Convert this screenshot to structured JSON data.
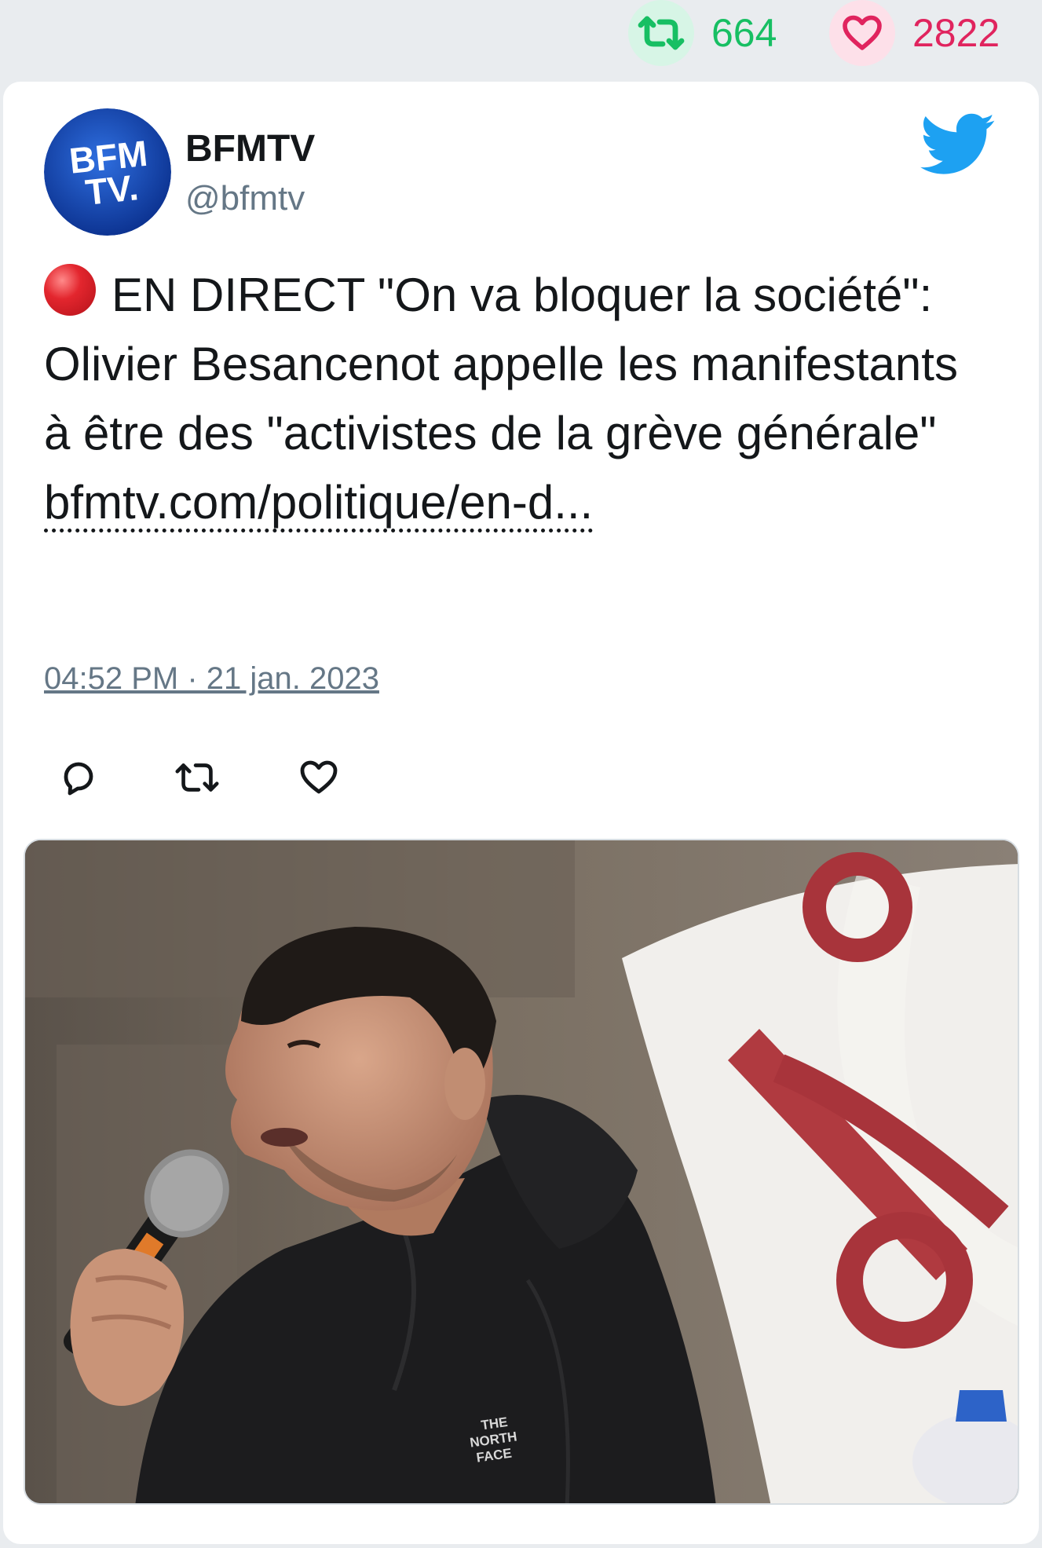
{
  "stats": {
    "retweets": "664",
    "likes": "2822"
  },
  "account": {
    "avatar_text_line1": "BFM",
    "avatar_text_line2": "TV.",
    "name": "BFMTV",
    "handle": "@bfmtv"
  },
  "tweet": {
    "text": "EN DIRECT \"On va bloquer la société\": Olivier Besancenot appelle les manifestants à être des \"activistes de la grève générale\" ",
    "link": "bfmtv.com/politique/en-d...",
    "timestamp": "04:52 PM · 21 jan. 2023"
  },
  "icons": {
    "retweet_stat": "retweet-icon",
    "like_stat": "heart-icon",
    "logo": "twitter-bird-icon",
    "live": "red-circle-icon",
    "reply_action": "reply-icon",
    "retweet_action": "retweet-icon",
    "like_action": "heart-icon"
  },
  "colors": {
    "retweet": "#17bf63",
    "like": "#e0245e",
    "twitter_blue": "#1da1f2",
    "muted": "#657786",
    "text": "#14171a",
    "bfm_blue": "#0b3fa8"
  },
  "media": {
    "jacket_brand_line1": "THE",
    "jacket_brand_line2": "NORTH",
    "jacket_brand_line3": "FACE"
  }
}
